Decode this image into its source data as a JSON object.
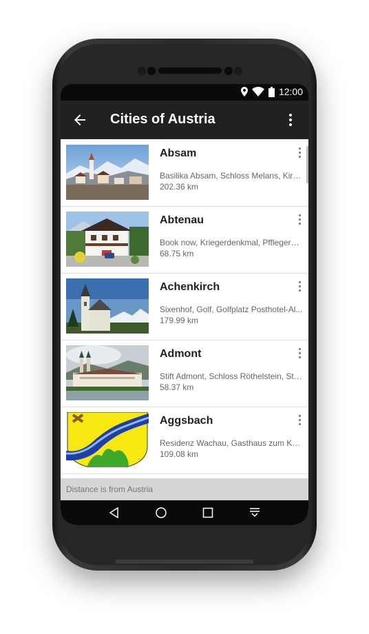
{
  "status_bar": {
    "time": "12:00",
    "icons": [
      "location-icon",
      "wifi-icon",
      "battery-icon"
    ]
  },
  "app_bar": {
    "title": "Cities of Austria",
    "back_icon": "arrow-back-icon",
    "menu_icon": "more-vert-icon"
  },
  "cities": [
    {
      "name": "Absam",
      "description": "Basilika Absam, Schloss Melans, Kirc...",
      "distance": "202.36 km",
      "image": "alpine-village-photo"
    },
    {
      "name": "Abtenau",
      "description": "Book now, Kriegerdenkmal, Pfflegerbr...",
      "distance": "68.75 km",
      "image": "chalet-house-photo"
    },
    {
      "name": "Achenkirch",
      "description": "Sixenhof, Golf, Golfplatz Posthotel-Al...",
      "distance": "179.99 km",
      "image": "church-mountains-photo"
    },
    {
      "name": "Admont",
      "description": "Stift Admont, Schloss Röthelstein, Stif...",
      "distance": "58.37 km",
      "image": "abbey-lake-photo"
    },
    {
      "name": "Aggsbach",
      "description": "Residenz Wachau, Gasthaus zum Kra...",
      "distance": "109.08 km",
      "image": "coat-of-arms"
    }
  ],
  "footer": {
    "text": "Distance is from Austria"
  },
  "nav_bar": {
    "buttons": [
      "back-nav-icon",
      "home-nav-icon",
      "recents-nav-icon",
      "notifications-nav-icon"
    ]
  },
  "colors": {
    "app_bar": "#212121",
    "status_bar": "#0a0a0a",
    "footer": "#d6d6d6"
  }
}
